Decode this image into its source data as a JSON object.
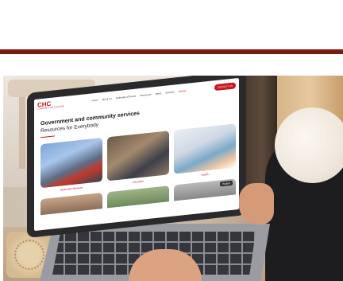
{
  "site": {
    "logo": {
      "mark": "CHC",
      "subtitle": "COMMUNITY HELP CENTRE"
    },
    "nav": {
      "items": [
        {
          "label": "Home"
        },
        {
          "label": "About Us"
        },
        {
          "label": "Calendar of Events"
        },
        {
          "label": "Resources"
        },
        {
          "label": "News"
        },
        {
          "label": "Services"
        },
        {
          "label": "Donate"
        }
      ],
      "contact_label": "CONTACT US"
    },
    "hero": {
      "title": "Government and community services",
      "subtitle": "Resources for Everybody"
    },
    "cards": [
      {
        "label": "Diplomatic Missions"
      },
      {
        "label": "Education"
      },
      {
        "label": "Health"
      }
    ],
    "language_chip": "English"
  },
  "colors": {
    "brand_bar": "#7a1a14",
    "accent_red": "#c8161d"
  }
}
